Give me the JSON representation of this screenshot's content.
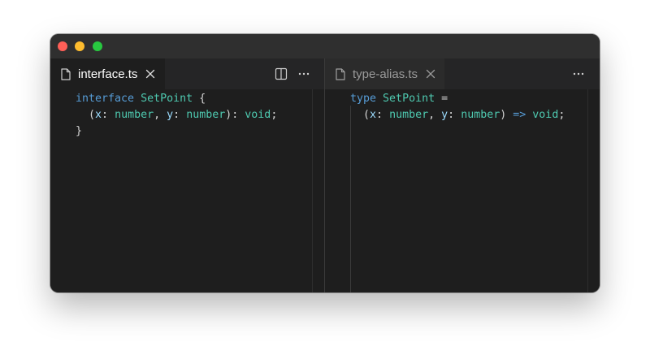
{
  "colors": {
    "keyword": "#569cd6",
    "type": "#4ec9b0",
    "identifier": "#9cdcfe",
    "punctuation": "#d4d4d4",
    "editor_bg": "#1e1e1e",
    "titlebar_bg": "#2f2f2f"
  },
  "window": {
    "traffic_lights": [
      "close",
      "minimize",
      "maximize"
    ]
  },
  "left_pane": {
    "tab": {
      "label": "interface.ts",
      "icon": "file-icon",
      "close_icon": "close-icon",
      "active": true
    },
    "actions": [
      "split-editor-icon",
      "more-actions-icon"
    ],
    "code": {
      "line1": {
        "kw": "interface",
        "name": "SetPoint",
        "brace": "{"
      },
      "line2": {
        "open": "(",
        "p1": "x",
        "c1": ":",
        "t1": "number",
        "comma": ",",
        "p2": "y",
        "c2": ":",
        "t2": "number",
        "close": ")",
        "c3": ":",
        "ret": "void",
        "semi": ";"
      },
      "line3": {
        "brace": "}"
      }
    }
  },
  "right_pane": {
    "tab": {
      "label": "type-alias.ts",
      "icon": "file-icon",
      "close_icon": "close-icon",
      "active": false
    },
    "actions": [
      "more-actions-icon"
    ],
    "code": {
      "line1": {
        "kw": "type",
        "name": "SetPoint",
        "eq": "="
      },
      "line2": {
        "open": "(",
        "p1": "x",
        "c1": ":",
        "t1": "number",
        "comma": ",",
        "p2": "y",
        "c2": ":",
        "t2": "number",
        "close": ")",
        "arrow": "=>",
        "ret": "void",
        "semi": ";"
      }
    }
  }
}
